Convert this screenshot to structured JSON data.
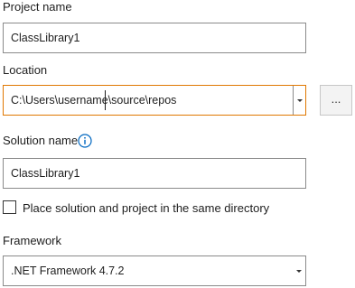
{
  "project": {
    "label": "Project name",
    "value": "ClassLibrary1"
  },
  "location": {
    "label": "Location",
    "value": "C:\\Users\\username\\source\\repos",
    "browse_label": "..."
  },
  "solution": {
    "label": "Solution name",
    "value": "ClassLibrary1",
    "info_icon": "info-icon"
  },
  "same_dir": {
    "label": "Place solution and project in the same directory",
    "checked": false
  },
  "framework": {
    "label": "Framework",
    "value": ".NET Framework 4.7.2"
  },
  "colors": {
    "focus_border": "#e07700",
    "info_blue": "#0067c0"
  }
}
